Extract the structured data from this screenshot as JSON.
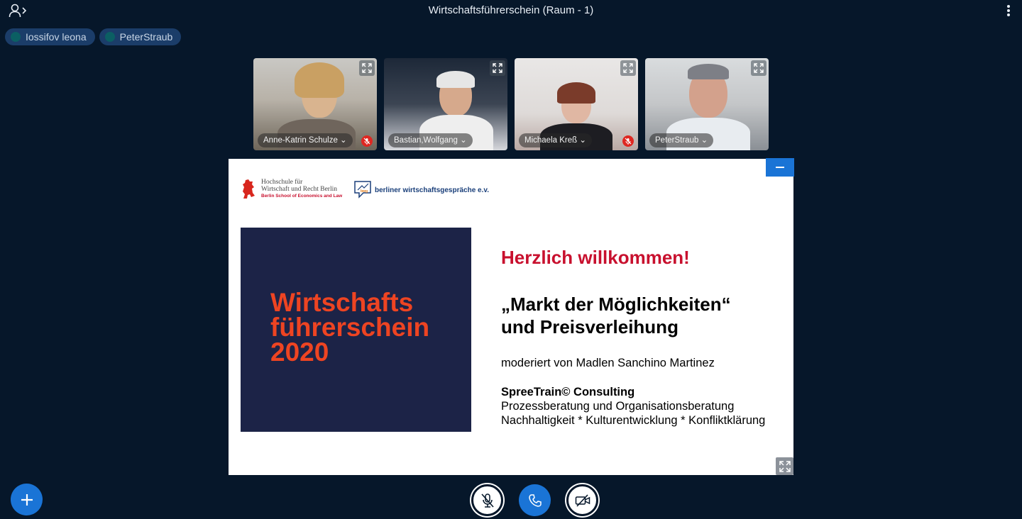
{
  "header": {
    "title": "Wirtschaftsführerschein (Raum - 1)",
    "users_icon": "user-list-toggle-icon",
    "options_icon": "kebab-menu-icon"
  },
  "talking_indicators": [
    {
      "name": "Iossifov leona"
    },
    {
      "name": "PeterStraub"
    }
  ],
  "video_tiles": [
    {
      "name": "Anne-Katrin Schulze",
      "muted": true
    },
    {
      "name": "Bastian,Wolfgang",
      "muted": false
    },
    {
      "name": "Michaela Kreß",
      "muted": true
    },
    {
      "name": "PeterStraub",
      "muted": false
    }
  ],
  "presentation": {
    "logo_hwr": {
      "line1": "Hochschule für",
      "line2": "Wirtschaft und Recht Berlin",
      "line3": "Berlin School of Economics and Law"
    },
    "logo_bwg": {
      "mark": "bwg",
      "text": "berliner wirtschaftsgespräche e.v."
    },
    "title_box": {
      "line1": "Wirtschafts",
      "line2": "führerschein",
      "line3": "2020"
    },
    "welcome": "Herzlich willkommen!",
    "headline1": "„Markt der Möglichkeiten“",
    "headline2": "und Preisverleihung",
    "moderator": "moderiert von Madlen Sanchino Martinez",
    "company": "SpreeTrain© Consulting",
    "company_line1": "Prozessberatung und Organisationsberatung",
    "company_line2": "Nachhaltigkeit * Kulturentwicklung * Konfliktklärung"
  },
  "colors": {
    "background": "#06172a",
    "accent_blue": "#1a74d6",
    "talker_pill": "#1b3d69",
    "muted_red": "#df2721",
    "slide_red": "#c8102e",
    "slide_orange": "#ee4422",
    "slide_navy": "#1c2347"
  }
}
